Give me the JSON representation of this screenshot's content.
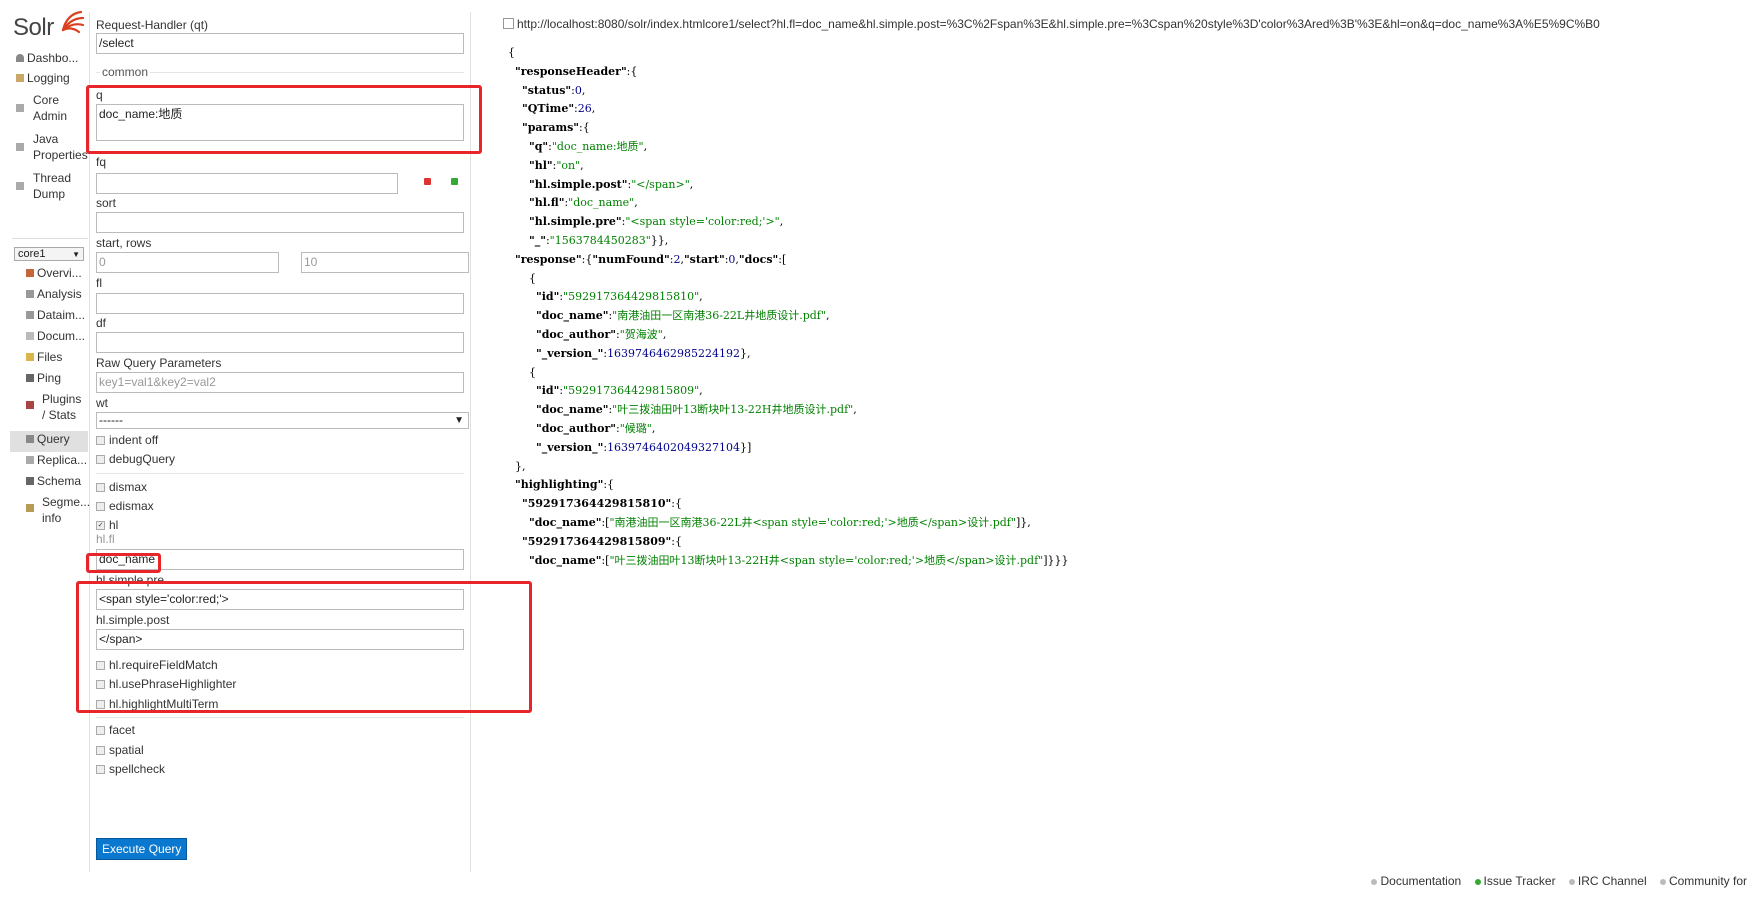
{
  "app": {
    "logo_text": "Solr"
  },
  "nav": {
    "main": [
      {
        "label": "Dashbo..."
      },
      {
        "label": "Logging"
      },
      {
        "label": "Core Admin"
      },
      {
        "label": "Java Properties"
      },
      {
        "label": "Thread Dump"
      }
    ],
    "core_selector": "core1",
    "core_items": [
      {
        "label": "Overvi..."
      },
      {
        "label": "Analysis"
      },
      {
        "label": "Dataim..."
      },
      {
        "label": "Docum..."
      },
      {
        "label": "Files"
      },
      {
        "label": "Ping"
      },
      {
        "label": "Plugins / Stats"
      },
      {
        "label": "Query"
      },
      {
        "label": "Replica..."
      },
      {
        "label": "Schema"
      },
      {
        "label": "Segme... info"
      }
    ]
  },
  "form": {
    "request_handler_label": "Request-Handler (qt)",
    "request_handler_value": "/select",
    "common_legend": "common",
    "q_label": "q",
    "q_value": "doc_name:地质",
    "fq_label": "fq",
    "fq_value": "",
    "sort_label": "sort",
    "sort_value": "",
    "start_rows_label": "start, rows",
    "start_value": "0",
    "rows_value": "10",
    "fl_label": "fl",
    "fl_value": "",
    "df_label": "df",
    "df_value": "",
    "raw_label": "Raw Query Parameters",
    "raw_placeholder": "key1=val1&key2=val2",
    "wt_label": "wt",
    "wt_value": "------",
    "indent_label": "indent off",
    "debug_label": "debugQuery",
    "dismax_label": "dismax",
    "edismax_label": "edismax",
    "hl_label": "hl",
    "hl_fl_label": "hl.fl",
    "hl_fl_value": "doc_name",
    "hl_pre_label": "hl.simple.pre",
    "hl_pre_value": "<span style='color:red;'>",
    "hl_post_label": "hl.simple.post",
    "hl_post_value": "</span>",
    "require_field_match_label": "hl.requireFieldMatch",
    "use_phrase_label": "hl.usePhraseHighlighter",
    "multi_term_label": "hl.highlightMultiTerm",
    "facet_label": "facet",
    "spatial_label": "spatial",
    "spellcheck_label": "spellcheck",
    "execute_label": "Execute Query"
  },
  "result": {
    "url": "http://localhost:8080/solr/index.htmlcore1/select?hl.fl=doc_name&hl.simple.post=%3C%2Fspan%3E&hl.simple.pre=%3Cspan%20style%3D'color%3Ared%3B'%3E&hl=on&q=doc_name%3A%E5%9C%B0",
    "lines": [
      "{",
      "  \"responseHeader\":{",
      "    \"status\":0,",
      "    \"QTime\":26,",
      "    \"params\":{",
      "      \"q\":\"doc_name:地质\",",
      "      \"hl\":\"on\",",
      "      \"hl.simple.post\":\"</span>\",",
      "      \"hl.fl\":\"doc_name\",",
      "      \"hl.simple.pre\":\"<span style='color:red;'>\",",
      "      \"_\":\"1563784450283\"}},",
      "  \"response\":{\"numFound\":2,\"start\":0,\"docs\":[",
      "      {",
      "        \"id\":\"592917364429815810\",",
      "        \"doc_name\":\"南港油田一区南港36-22L井地质设计.pdf\",",
      "        \"doc_author\":\"贺海波\",",
      "        \"_version_\":1639746462985224192},",
      "      {",
      "        \"id\":\"592917364429815809\",",
      "        \"doc_name\":\"叶三拨油田叶13断块叶13-22H井地质设计.pdf\",",
      "        \"doc_author\":\"候璐\",",
      "        \"_version_\":1639746402049327104}]",
      "  },",
      "  \"highlighting\":{",
      "    \"592917364429815810\":{",
      "      \"doc_name\":[\"南港油田一区南港36-22L井<span style='color:red;'>地质</span>设计.pdf\"]},",
      "    \"592917364429815809\":{",
      "      \"doc_name\":[\"叶三拨油田叶13断块叶13-22H井<span style='color:red;'>地质</span>设计.pdf\"]}}}"
    ]
  },
  "footer": {
    "links": [
      "Documentation",
      "Issue Tracker",
      "IRC Channel",
      "Community for"
    ]
  },
  "colors": {
    "accent": "#0a78cf",
    "annotation_red": "#e8252b",
    "json_string": "#008000",
    "json_number": "#00008b"
  }
}
